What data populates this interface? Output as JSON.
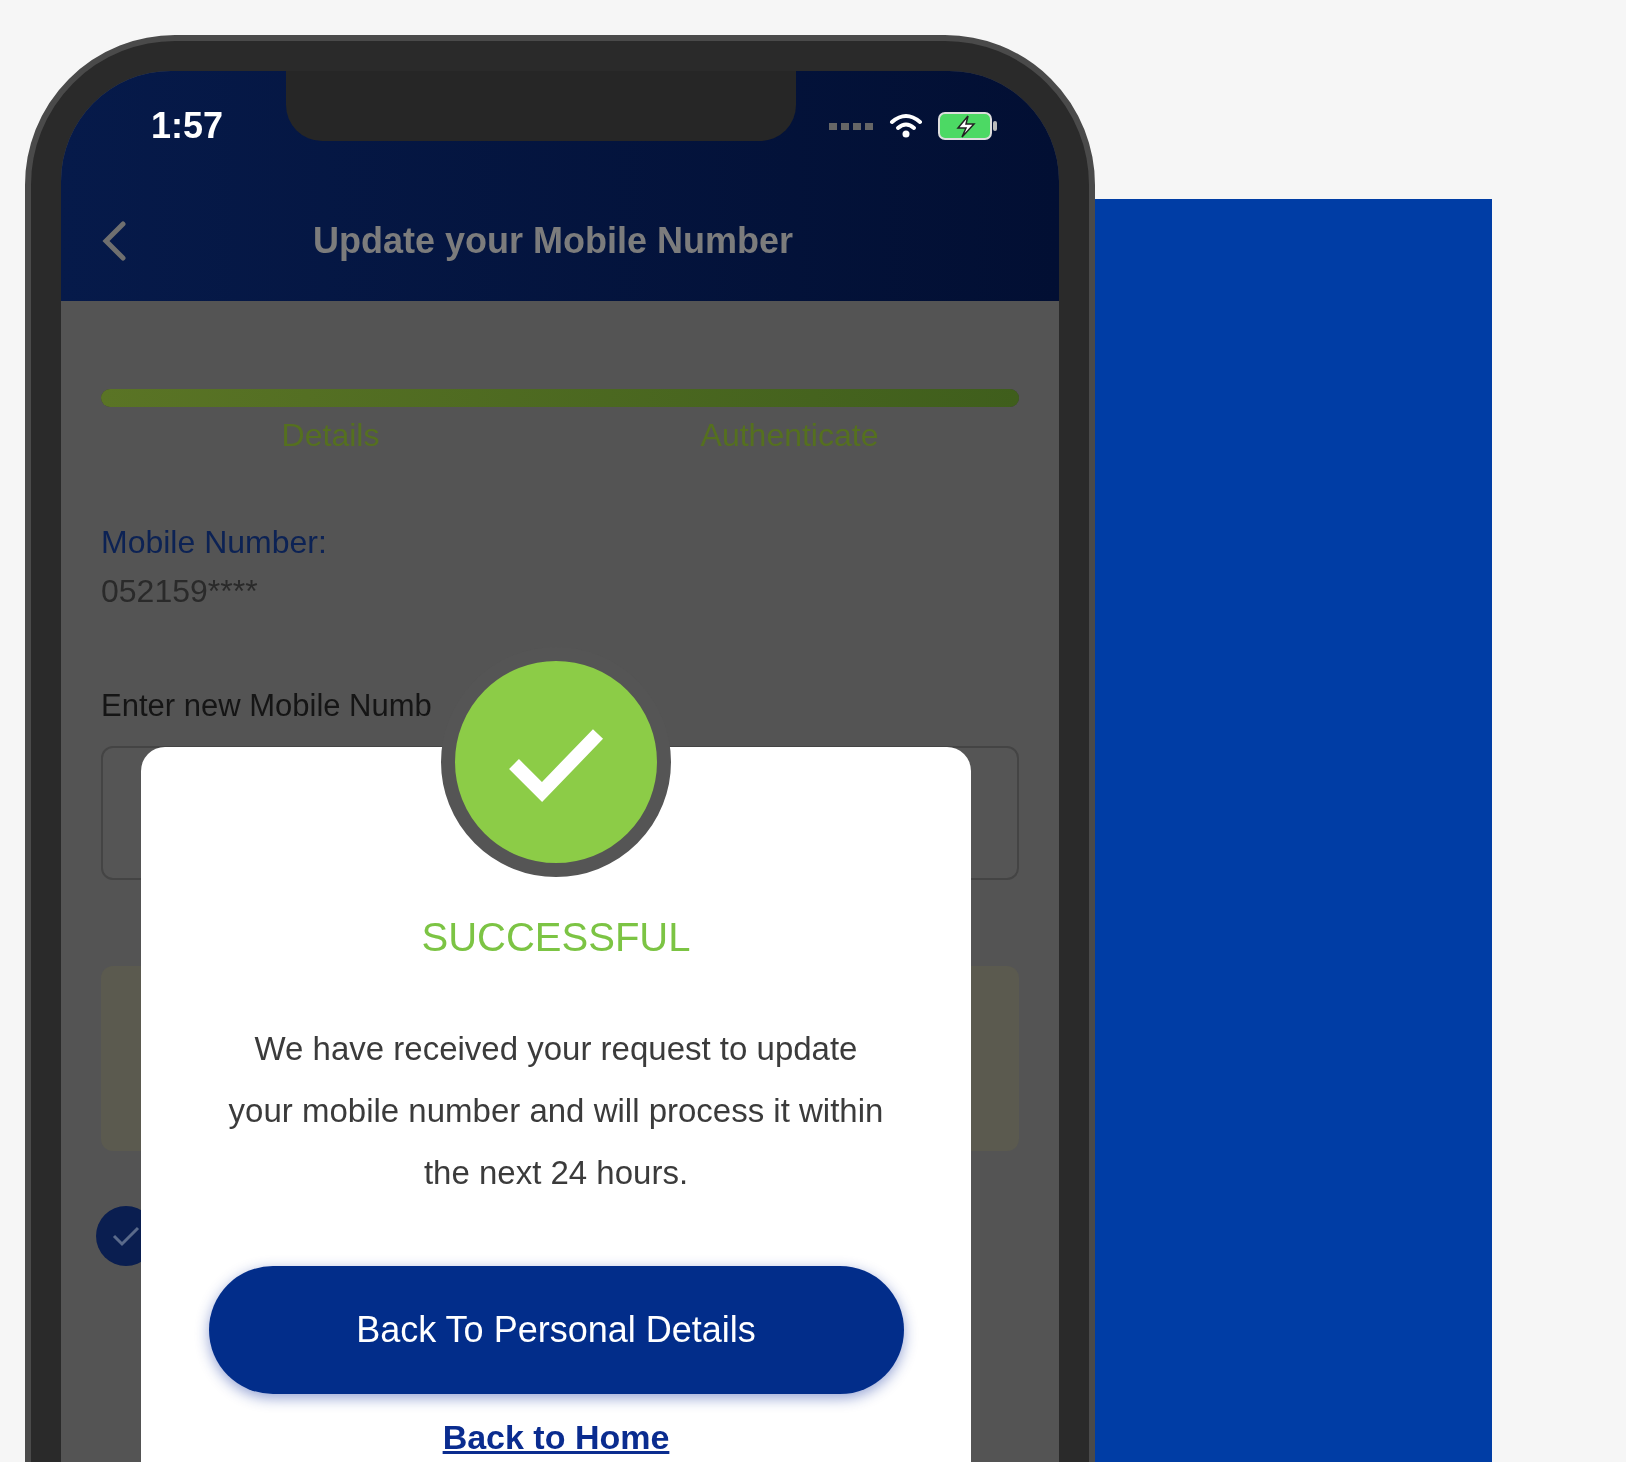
{
  "status_bar": {
    "time": "1:57"
  },
  "header": {
    "title": "Update your Mobile Number"
  },
  "progress": {
    "level": 1,
    "steps": [
      {
        "label": "Details"
      },
      {
        "label": "Authenticate"
      }
    ]
  },
  "current_number": {
    "label": "Mobile Number:",
    "value": "052159****"
  },
  "new_number": {
    "label": "Enter new Mobile Numb"
  },
  "consent_checkbox": {
    "checked": true
  },
  "dialog": {
    "title": "SUCCESSFUL",
    "message": "We have received your request to update your mobile number and will process it within the next 24 hours.",
    "primary_button": "Back To Personal Details",
    "link": "Back to Home"
  }
}
